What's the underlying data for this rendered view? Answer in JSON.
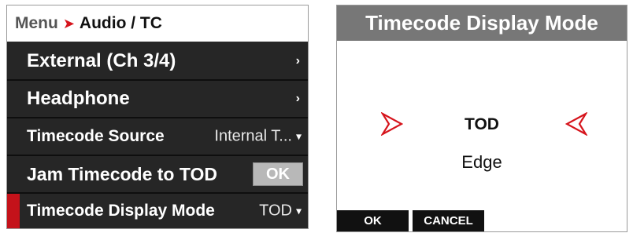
{
  "menu": {
    "breadcrumb_root": "Menu",
    "breadcrumb_current": "Audio / TC",
    "items": [
      {
        "label": "External (Ch 3/4)",
        "chevron": "›"
      },
      {
        "label": "Headphone",
        "chevron": "›"
      },
      {
        "label": "Timecode Source",
        "value": "Internal T...",
        "caret": "▾"
      },
      {
        "label": "Jam Timecode to TOD",
        "button": "OK"
      },
      {
        "label": "Timecode Display Mode",
        "value": "TOD",
        "caret": "▾"
      }
    ]
  },
  "dialog": {
    "title": "Timecode Display Mode",
    "options": [
      "TOD",
      "Edge"
    ],
    "selected": "TOD",
    "ok_label": "OK",
    "cancel_label": "CANCEL"
  },
  "colors": {
    "accent": "#d6141c",
    "menu_bg": "#262626",
    "title_bar": "#777777"
  },
  "icons": {
    "breadcrumb_separator": "chevron-right-icon",
    "option_selector_left": "arrow-right-outline-icon",
    "option_selector_right": "arrow-left-outline-icon"
  }
}
